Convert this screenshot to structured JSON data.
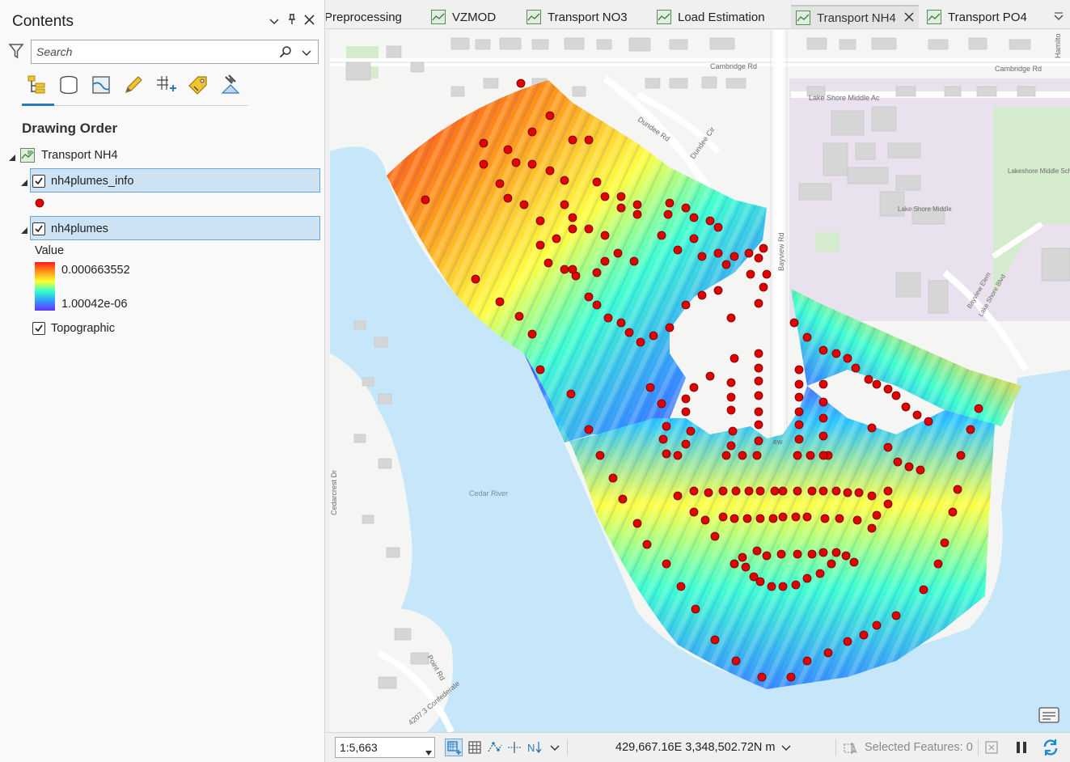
{
  "contents": {
    "title": "Contents",
    "search_placeholder": "Search",
    "section_title": "Drawing Order",
    "map_name": "Transport NH4",
    "layers": [
      {
        "name": "nh4plumes_info",
        "checked": true
      },
      {
        "name": "nh4plumes",
        "checked": true
      }
    ],
    "legend": {
      "field": "Value",
      "max_label": "0.000663552",
      "min_label": "1.00042e-06"
    },
    "basemap": {
      "name": "Topographic",
      "checked": true
    },
    "point_color": "#e00000"
  },
  "tabs": [
    {
      "label": "Preprocessing",
      "active": false
    },
    {
      "label": "VZMOD",
      "active": false
    },
    {
      "label": "Transport NO3",
      "active": false
    },
    {
      "label": "Load Estimation",
      "active": false
    },
    {
      "label": "Transport NH4",
      "active": true
    },
    {
      "label": "Transport PO4",
      "active": false
    }
  ],
  "map": {
    "labels": {
      "cambridge1": "Cambridge Rd",
      "cambridge2": "Cambridge Rd",
      "lakeshore_ave": "Lake Shore Middle Ac",
      "school": "Lakeshore Middle School",
      "school2": "Lake Shore Middle",
      "dundee_rd": "Dundee Rd",
      "dundee_cir": "Dundee Cir",
      "bayview_rd": "Bayview Rd",
      "bayview_elem": "Bayview Elem",
      "lakeshore_blvd": "Lake Shore Blvd",
      "cedar_river": "Cedar River",
      "cedarcrest": "Cedarcrest Dr",
      "confederate": "4207.3 Confederate",
      "point_rd": "Point Rd",
      "hamilton": "Hamilto",
      "bayview_short": "ew"
    }
  },
  "statusbar": {
    "scale": "1:5,663",
    "coordinates": "429,667.16E 3,348,502.72N m",
    "selected_features": "Selected Features: 0"
  }
}
